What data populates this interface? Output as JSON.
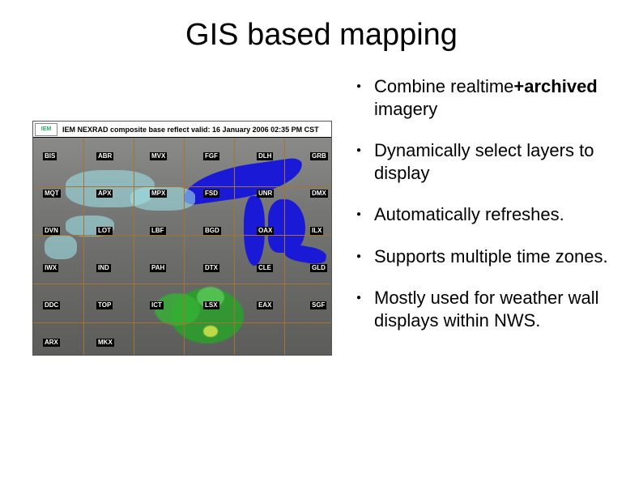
{
  "title": "GIS based mapping",
  "map": {
    "logo_text": "IEM",
    "caption": "IEM NEXRAD composite base reflect valid: 16 January 2006 02:35 PM CST",
    "stations": [
      "BIS",
      "ABR",
      "MVX",
      "FGF",
      "DLH",
      "GRB",
      "MQT",
      "APX",
      "MPX",
      "FSD",
      "UNR",
      "DMX",
      "DVN",
      "LOT",
      "LBF",
      "BGD",
      "OAX",
      "ILX",
      "IWX",
      "IND",
      "PAH",
      "DTX",
      "CLE",
      "GLD",
      "DDC",
      "TOP",
      "ICT",
      "LSX",
      "EAX",
      "SGF",
      "ARX",
      "MKX"
    ]
  },
  "bullets": [
    {
      "pre": "Combine realtime",
      "bold": "+archived",
      "post": " imagery"
    },
    {
      "pre": "Dynamically select layers to display",
      "bold": "",
      "post": ""
    },
    {
      "pre": "Automatically refreshes.",
      "bold": "",
      "post": ""
    },
    {
      "pre": "Supports multiple time zones.",
      "bold": "",
      "post": ""
    },
    {
      "pre": "Mostly used for weather wall displays within NWS.",
      "bold": "",
      "post": ""
    }
  ]
}
